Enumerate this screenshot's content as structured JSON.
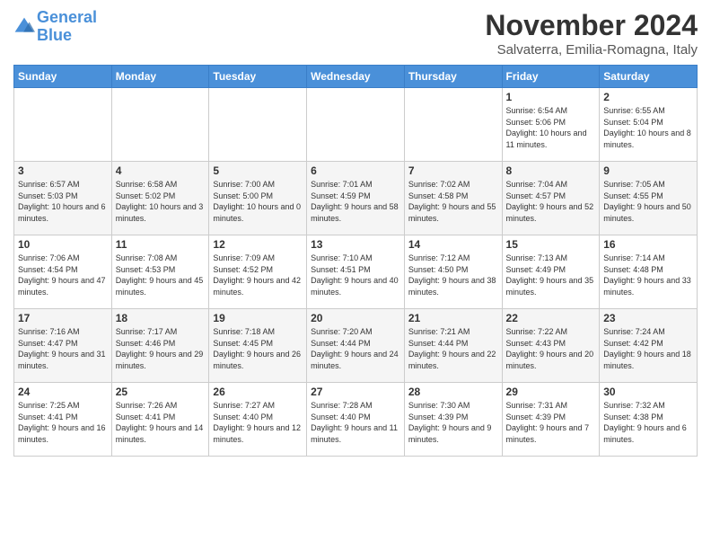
{
  "logo": {
    "line1": "General",
    "line2": "Blue"
  },
  "title": "November 2024",
  "location": "Salvaterra, Emilia-Romagna, Italy",
  "days_header": [
    "Sunday",
    "Monday",
    "Tuesday",
    "Wednesday",
    "Thursday",
    "Friday",
    "Saturday"
  ],
  "weeks": [
    [
      {
        "day": "",
        "info": ""
      },
      {
        "day": "",
        "info": ""
      },
      {
        "day": "",
        "info": ""
      },
      {
        "day": "",
        "info": ""
      },
      {
        "day": "",
        "info": ""
      },
      {
        "day": "1",
        "info": "Sunrise: 6:54 AM\nSunset: 5:06 PM\nDaylight: 10 hours and 11 minutes."
      },
      {
        "day": "2",
        "info": "Sunrise: 6:55 AM\nSunset: 5:04 PM\nDaylight: 10 hours and 8 minutes."
      }
    ],
    [
      {
        "day": "3",
        "info": "Sunrise: 6:57 AM\nSunset: 5:03 PM\nDaylight: 10 hours and 6 minutes."
      },
      {
        "day": "4",
        "info": "Sunrise: 6:58 AM\nSunset: 5:02 PM\nDaylight: 10 hours and 3 minutes."
      },
      {
        "day": "5",
        "info": "Sunrise: 7:00 AM\nSunset: 5:00 PM\nDaylight: 10 hours and 0 minutes."
      },
      {
        "day": "6",
        "info": "Sunrise: 7:01 AM\nSunset: 4:59 PM\nDaylight: 9 hours and 58 minutes."
      },
      {
        "day": "7",
        "info": "Sunrise: 7:02 AM\nSunset: 4:58 PM\nDaylight: 9 hours and 55 minutes."
      },
      {
        "day": "8",
        "info": "Sunrise: 7:04 AM\nSunset: 4:57 PM\nDaylight: 9 hours and 52 minutes."
      },
      {
        "day": "9",
        "info": "Sunrise: 7:05 AM\nSunset: 4:55 PM\nDaylight: 9 hours and 50 minutes."
      }
    ],
    [
      {
        "day": "10",
        "info": "Sunrise: 7:06 AM\nSunset: 4:54 PM\nDaylight: 9 hours and 47 minutes."
      },
      {
        "day": "11",
        "info": "Sunrise: 7:08 AM\nSunset: 4:53 PM\nDaylight: 9 hours and 45 minutes."
      },
      {
        "day": "12",
        "info": "Sunrise: 7:09 AM\nSunset: 4:52 PM\nDaylight: 9 hours and 42 minutes."
      },
      {
        "day": "13",
        "info": "Sunrise: 7:10 AM\nSunset: 4:51 PM\nDaylight: 9 hours and 40 minutes."
      },
      {
        "day": "14",
        "info": "Sunrise: 7:12 AM\nSunset: 4:50 PM\nDaylight: 9 hours and 38 minutes."
      },
      {
        "day": "15",
        "info": "Sunrise: 7:13 AM\nSunset: 4:49 PM\nDaylight: 9 hours and 35 minutes."
      },
      {
        "day": "16",
        "info": "Sunrise: 7:14 AM\nSunset: 4:48 PM\nDaylight: 9 hours and 33 minutes."
      }
    ],
    [
      {
        "day": "17",
        "info": "Sunrise: 7:16 AM\nSunset: 4:47 PM\nDaylight: 9 hours and 31 minutes."
      },
      {
        "day": "18",
        "info": "Sunrise: 7:17 AM\nSunset: 4:46 PM\nDaylight: 9 hours and 29 minutes."
      },
      {
        "day": "19",
        "info": "Sunrise: 7:18 AM\nSunset: 4:45 PM\nDaylight: 9 hours and 26 minutes."
      },
      {
        "day": "20",
        "info": "Sunrise: 7:20 AM\nSunset: 4:44 PM\nDaylight: 9 hours and 24 minutes."
      },
      {
        "day": "21",
        "info": "Sunrise: 7:21 AM\nSunset: 4:44 PM\nDaylight: 9 hours and 22 minutes."
      },
      {
        "day": "22",
        "info": "Sunrise: 7:22 AM\nSunset: 4:43 PM\nDaylight: 9 hours and 20 minutes."
      },
      {
        "day": "23",
        "info": "Sunrise: 7:24 AM\nSunset: 4:42 PM\nDaylight: 9 hours and 18 minutes."
      }
    ],
    [
      {
        "day": "24",
        "info": "Sunrise: 7:25 AM\nSunset: 4:41 PM\nDaylight: 9 hours and 16 minutes."
      },
      {
        "day": "25",
        "info": "Sunrise: 7:26 AM\nSunset: 4:41 PM\nDaylight: 9 hours and 14 minutes."
      },
      {
        "day": "26",
        "info": "Sunrise: 7:27 AM\nSunset: 4:40 PM\nDaylight: 9 hours and 12 minutes."
      },
      {
        "day": "27",
        "info": "Sunrise: 7:28 AM\nSunset: 4:40 PM\nDaylight: 9 hours and 11 minutes."
      },
      {
        "day": "28",
        "info": "Sunrise: 7:30 AM\nSunset: 4:39 PM\nDaylight: 9 hours and 9 minutes."
      },
      {
        "day": "29",
        "info": "Sunrise: 7:31 AM\nSunset: 4:39 PM\nDaylight: 9 hours and 7 minutes."
      },
      {
        "day": "30",
        "info": "Sunrise: 7:32 AM\nSunset: 4:38 PM\nDaylight: 9 hours and 6 minutes."
      }
    ]
  ]
}
